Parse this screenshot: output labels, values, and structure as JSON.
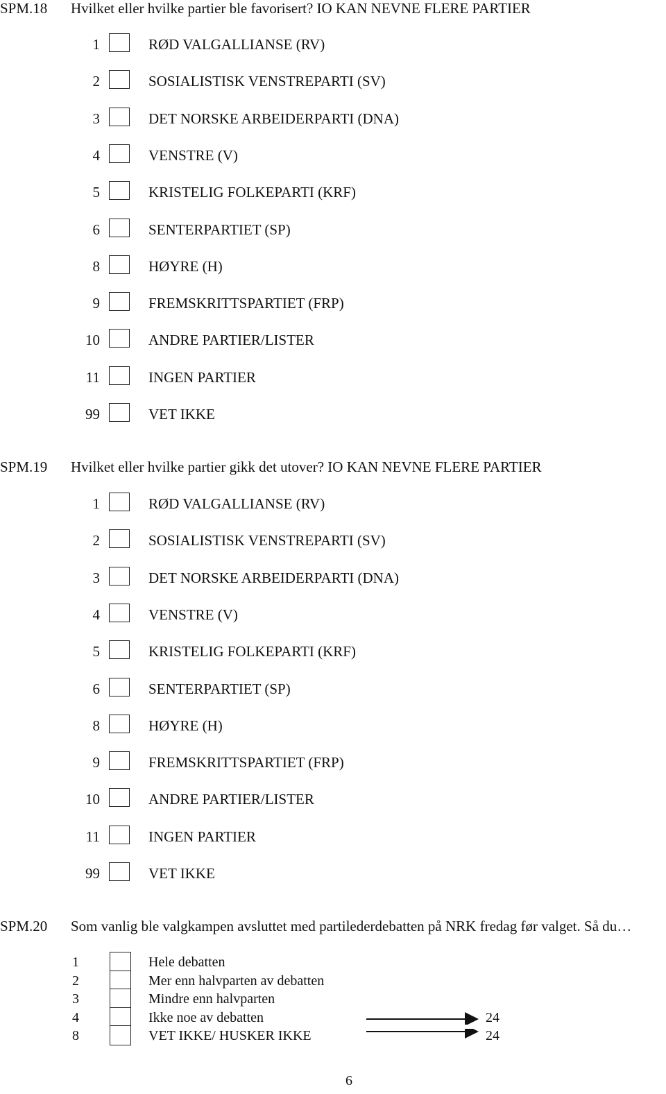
{
  "questions": [
    {
      "code": "SPM.18",
      "text": "Hvilket eller hvilke partier ble favorisert? IO KAN NEVNE FLERE PARTIER",
      "options": [
        {
          "num": "1",
          "label": "RØD VALGALLIANSE (RV)"
        },
        {
          "num": "2",
          "label": "SOSIALISTISK VENSTREPARTI (SV)"
        },
        {
          "num": "3",
          "label": "DET NORSKE ARBEIDERPARTI (DNA)"
        },
        {
          "num": "4",
          "label": "VENSTRE (V)"
        },
        {
          "num": "5",
          "label": "KRISTELIG FOLKEPARTI (KRF)"
        },
        {
          "num": "6",
          "label": "SENTERPARTIET (SP)"
        },
        {
          "num": "8",
          "label": "HØYRE (H)"
        },
        {
          "num": "9",
          "label": "FREMSKRITTSPARTIET (FRP)"
        },
        {
          "num": "10",
          "label": "ANDRE PARTIER/LISTER"
        },
        {
          "num": "11",
          "label": "INGEN PARTIER"
        },
        {
          "num": "99",
          "label": "VET IKKE"
        }
      ]
    },
    {
      "code": "SPM.19",
      "text": "Hvilket eller hvilke partier gikk det utover? IO KAN NEVNE FLERE PARTIER",
      "options": [
        {
          "num": "1",
          "label": "RØD VALGALLIANSE (RV)"
        },
        {
          "num": "2",
          "label": "SOSIALISTISK VENSTREPARTI (SV)"
        },
        {
          "num": "3",
          "label": "DET NORSKE ARBEIDERPARTI (DNA)"
        },
        {
          "num": "4",
          "label": "VENSTRE (V)"
        },
        {
          "num": "5",
          "label": "KRISTELIG FOLKEPARTI (KRF)"
        },
        {
          "num": "6",
          "label": "SENTERPARTIET (SP)"
        },
        {
          "num": "8",
          "label": "HØYRE (H)"
        },
        {
          "num": "9",
          "label": "FREMSKRITTSPARTIET (FRP)"
        },
        {
          "num": "10",
          "label": "ANDRE PARTIER/LISTER"
        },
        {
          "num": "11",
          "label": "INGEN PARTIER"
        },
        {
          "num": "99",
          "label": "VET IKKE"
        }
      ]
    },
    {
      "code": "SPM.20",
      "text": "Som vanlig ble valgkampen avsluttet med partilederdebatten på NRK fredag før valget. Så du…",
      "options": [
        {
          "num": "1",
          "label": "Hele debatten",
          "skip_to": null
        },
        {
          "num": "2",
          "label": "Mer enn halvparten av debatten",
          "skip_to": null
        },
        {
          "num": "3",
          "label": "Mindre enn halvparten",
          "skip_to": null
        },
        {
          "num": "4",
          "label": "Ikke noe av debatten",
          "skip_to": "24"
        },
        {
          "num": "8",
          "label": "VET IKKE/ HUSKER IKKE",
          "skip_to": "24"
        }
      ]
    }
  ],
  "icons": {
    "checkbox": "empty-square-checkbox",
    "skip_arrow": "right-arrow"
  },
  "page_number": "6"
}
